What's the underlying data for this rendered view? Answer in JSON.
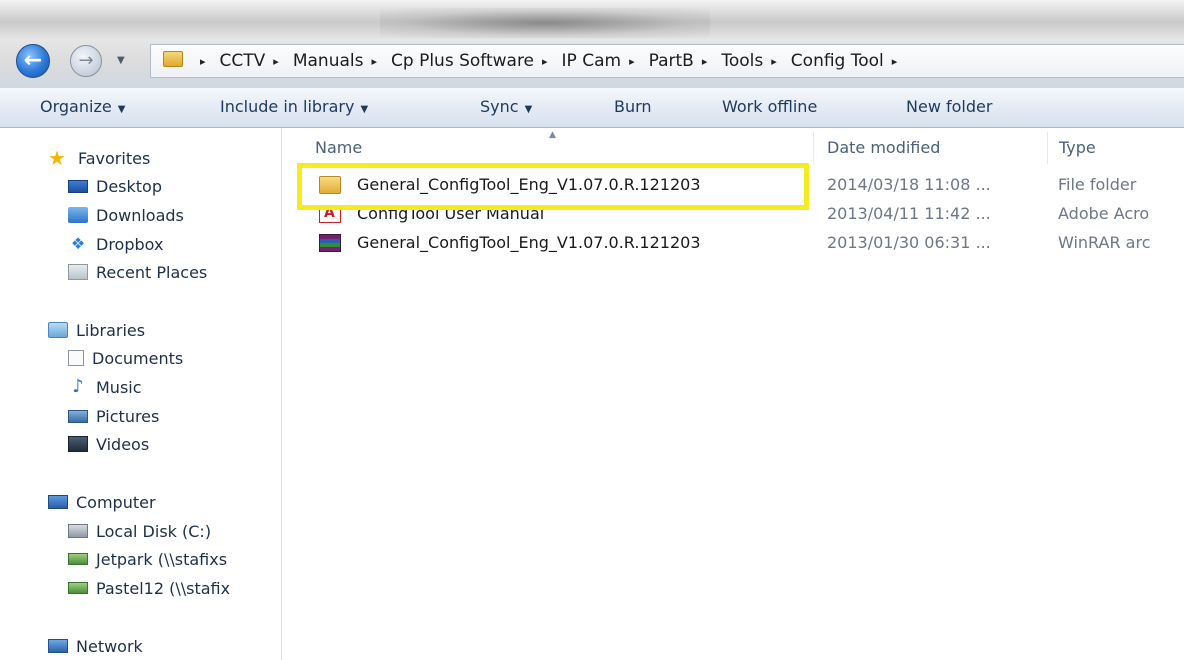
{
  "address_bar": {
    "breadcrumbs": [
      "CCTV",
      "Manuals",
      "Cp Plus Software",
      "IP Cam",
      "PartB",
      "Tools",
      "Config Tool"
    ],
    "separator": "▸"
  },
  "toolbar": {
    "organize": "Organize",
    "include_in_library": "Include in library",
    "sync": "Sync",
    "burn": "Burn",
    "work_offline": "Work offline",
    "new_folder": "New folder"
  },
  "nav": {
    "favorites": {
      "label": "Favorites",
      "items": [
        "Desktop",
        "Downloads",
        "Dropbox",
        "Recent Places"
      ]
    },
    "libraries": {
      "label": "Libraries",
      "items": [
        "Documents",
        "Music",
        "Pictures",
        "Videos"
      ]
    },
    "computer": {
      "label": "Computer",
      "items": [
        "Local Disk (C:)",
        "Jetpark (\\\\stafixs",
        "Pastel12 (\\\\stafix"
      ]
    },
    "network": {
      "label": "Network"
    }
  },
  "columns": {
    "name": "Name",
    "date_modified": "Date modified",
    "type": "Type"
  },
  "files": [
    {
      "name": "General_ConfigTool_Eng_V1.07.0.R.121203",
      "date": "2014/03/18 11:08 ...",
      "type": "File folder",
      "icon": "folder-icon",
      "highlighted": true
    },
    {
      "name": "ConfigTool User Manual",
      "date": "2013/04/11 11:42 ...",
      "type": "Adobe Acro",
      "icon": "pdf-icon",
      "highlighted": false
    },
    {
      "name": "General_ConfigTool_Eng_V1.07.0.R.121203",
      "date": "2013/01/30 06:31 ...",
      "type": "WinRAR arc",
      "icon": "rar-archive-icon",
      "highlighted": false
    }
  ],
  "colors": {
    "highlight_border": "#f4ec1f",
    "toolbar_text": "#1e395b"
  }
}
